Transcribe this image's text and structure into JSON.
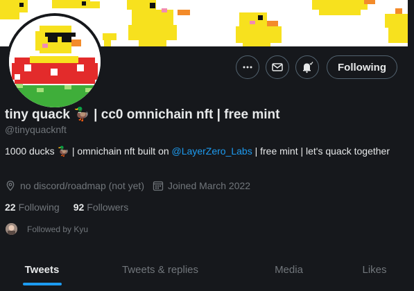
{
  "profile": {
    "name": "tiny quack 🦆 | cc0 omnichain nft | free mint",
    "handle": "@tinyquacknft",
    "bio_prefix": "1000 ducks 🦆 | omnichain nft built on ",
    "bio_mention": "@LayerZero_Labs",
    "bio_suffix": " | free mint | let's quack together",
    "location": "no discord/roadmap (not yet)",
    "joined": "Joined March 2022",
    "following_count": "22",
    "following_label": "Following",
    "followers_count": "92",
    "followers_label": "Followers",
    "followed_by": "Followed by Kyu"
  },
  "actions": {
    "following_button": "Following"
  },
  "tabs": [
    {
      "label": "Tweets",
      "active": true
    },
    {
      "label": "Tweets & replies",
      "active": false
    },
    {
      "label": "Media",
      "active": false
    },
    {
      "label": "Likes",
      "active": false
    }
  ],
  "colors": {
    "background": "#16181c",
    "accent": "#1d9bf0",
    "muted_text": "#71767b",
    "primary_text": "#e7e9ea"
  }
}
